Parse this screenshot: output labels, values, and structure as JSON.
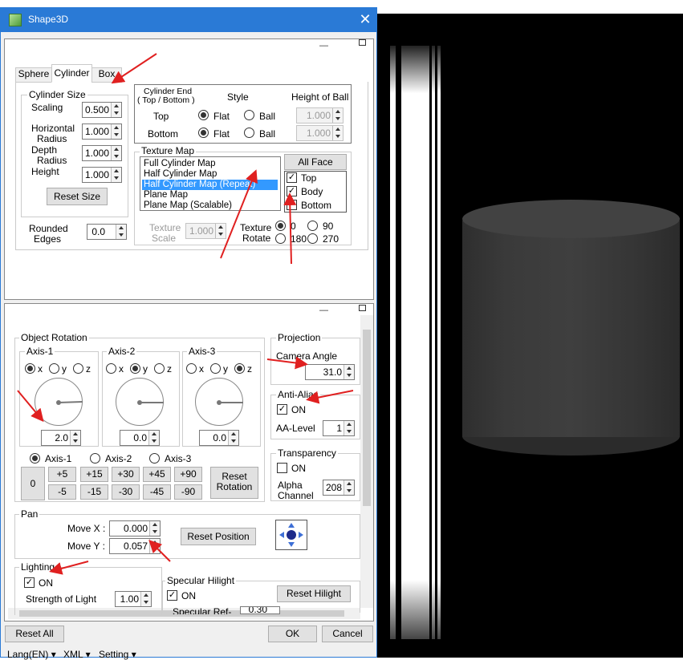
{
  "window": {
    "title": "Shape3D",
    "icon": "cube-icon",
    "close_glyph": "✕"
  },
  "top_panel": {
    "tabs": [
      "Sphere",
      "Cylinder",
      "Box"
    ],
    "active_tab": "Cylinder",
    "cylinder_size": {
      "label": "Cylinder Size",
      "scaling_label": "Scaling",
      "scaling_value": "0.500",
      "hradius_label1": "Horizontal",
      "hradius_label2": "Radius",
      "hradius_value": "1.000",
      "dradius_label1": "Depth",
      "dradius_label2": "Radius",
      "dradius_value": "1.000",
      "height_label": "Height",
      "height_value": "1.000",
      "reset_button": "Reset Size"
    },
    "rounded_edges": {
      "label1": "Rounded",
      "label2": "Edges",
      "value": "0.0"
    },
    "cylinder_end": {
      "header_line1": "Cylinder End",
      "header_line2": "( Top / Bottom )",
      "style_header": "Style",
      "height_header": "Height of Ball",
      "top_label": "Top",
      "bottom_label": "Bottom",
      "flat_label": "Flat",
      "ball_label": "Ball",
      "top_style": "Flat",
      "bottom_style": "Flat",
      "top_height": "1.000",
      "bottom_height": "1.000"
    },
    "texture_map": {
      "label": "Texture Map",
      "items": [
        "Full Cylinder Map",
        "Half Cylinder Map",
        "Half Cylinder Map (Repeat)",
        "Plane Map",
        "Plane Map (Scalable)"
      ],
      "selected": "Half Cylinder Map (Repeat)",
      "all_face_button": "All Face",
      "faces": [
        {
          "label": "Top",
          "checked": true
        },
        {
          "label": "Body",
          "checked": true
        },
        {
          "label": "Bottom",
          "checked": false
        }
      ],
      "scale_label1": "Texture",
      "scale_label2": "Scale",
      "scale_value": "1.000",
      "rotate_label1": "Texture",
      "rotate_label2": "Rotate",
      "rotate_options": [
        "0",
        "90",
        "180",
        "270"
      ],
      "rotate_selected": "0"
    }
  },
  "bottom_panel": {
    "object_rotation": {
      "label": "Object Rotation",
      "axes": [
        {
          "name": "Axis-1",
          "selected": "x",
          "value": "2.0",
          "angle_deg": 2
        },
        {
          "name": "Axis-2",
          "selected": "y",
          "value": "0.0",
          "angle_deg": 0
        },
        {
          "name": "Axis-3",
          "selected": "z",
          "value": "0.0",
          "angle_deg": 0
        }
      ],
      "axis_options": [
        "x",
        "y",
        "z"
      ],
      "target_axes": [
        "Axis-1",
        "Axis-2",
        "Axis-3"
      ],
      "target_selected": "Axis-1",
      "zero_button": "0",
      "plus_buttons": [
        "+5",
        "+15",
        "+30",
        "+45",
        "+90"
      ],
      "minus_buttons": [
        "-5",
        "-15",
        "-30",
        "-45",
        "-90"
      ],
      "reset_button_line1": "Reset",
      "reset_button_line2": "Rotation"
    },
    "projection": {
      "label": "Projection",
      "camera_label": "Camera Angle",
      "camera_value": "31.0"
    },
    "anti_alias": {
      "label": "Anti-Alias",
      "on_label": "ON",
      "on": true,
      "level_label": "AA-Level",
      "level_value": "1"
    },
    "transparency": {
      "label": "Transparency",
      "on_label": "ON",
      "on": false,
      "alpha_label1": "Alpha",
      "alpha_label2": "Channel",
      "alpha_value": "208"
    },
    "pan": {
      "label": "Pan",
      "move_x_label": "Move X :",
      "move_x_value": "0.000",
      "move_y_label": "Move Y :",
      "move_y_value": "0.057",
      "reset_button": "Reset Position",
      "pad_icon": "move-arrows-icon"
    },
    "lighting": {
      "label": "Lighting",
      "on_label": "ON",
      "on": true,
      "strength_label": "Strength of Light",
      "strength_value": "1.00"
    },
    "specular": {
      "label": "Specular Hilight",
      "on_label": "ON",
      "on": true,
      "reset_button": "Reset Hilight",
      "ref_label": "Specular Ref-",
      "ref_value": "0.30"
    }
  },
  "footer": {
    "reset_all": "Reset All",
    "ok": "OK",
    "cancel": "Cancel",
    "menu": [
      "Lang(EN)",
      "XML",
      "Setting"
    ]
  },
  "colors": {
    "titlebar": "#2a7ad6",
    "selection": "#3399ff",
    "annotation_arrow": "#e02020",
    "preview_bg": "#000000"
  }
}
